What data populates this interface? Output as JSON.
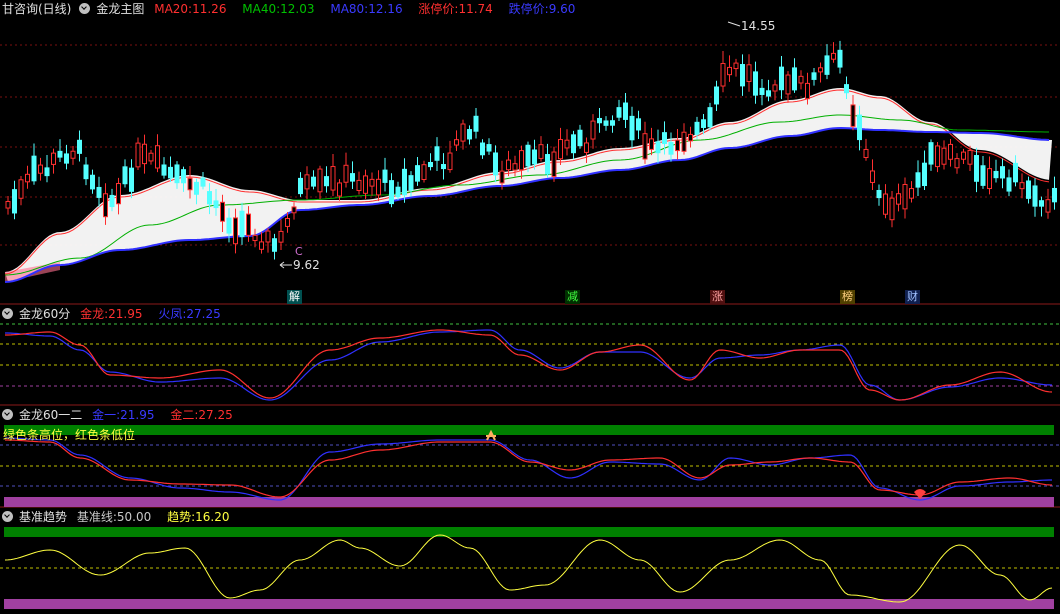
{
  "main": {
    "name": "甘咨询(日线)",
    "indicator": "金龙主图",
    "ma20_label": "MA20:",
    "ma20_value": "11.26",
    "ma40_label": "MA40:",
    "ma40_value": "12.03",
    "ma80_label": "MA80:",
    "ma80_value": "12.16",
    "limit_up_label": "涨停价:",
    "limit_up_value": "11.74",
    "limit_down_label": "跌停价:",
    "limit_down_value": "9.60",
    "high_mark": "14.55",
    "low_mark": "9.62",
    "c_mark": "C",
    "tags": [
      "解",
      "减",
      "涨",
      "榜",
      "财"
    ]
  },
  "panel2": {
    "title": "金龙60分",
    "s1_label": "金龙:",
    "s1_value": "21.95",
    "s2_label": "火凤:",
    "s2_value": "27.25"
  },
  "panel3": {
    "title": "金龙60一二",
    "s1_label": "金一:",
    "s1_value": "21.95",
    "s2_label": "金二:",
    "s2_value": "27.25",
    "note": "绿色条高位，红色条低位"
  },
  "panel4": {
    "title": "基准趋势",
    "s1_label": "基准线:",
    "s1_value": "50.00",
    "s2_label": "趋势:",
    "s2_value": "16.20"
  },
  "colors": {
    "up": "#ff3030",
    "down": "#54ffff",
    "ma20": "#ff3030",
    "ma40": "#00b000",
    "ma80": "#3030ff",
    "green_band": "#008000",
    "purple_band": "#a040a0",
    "trend": "#ffff40"
  }
}
